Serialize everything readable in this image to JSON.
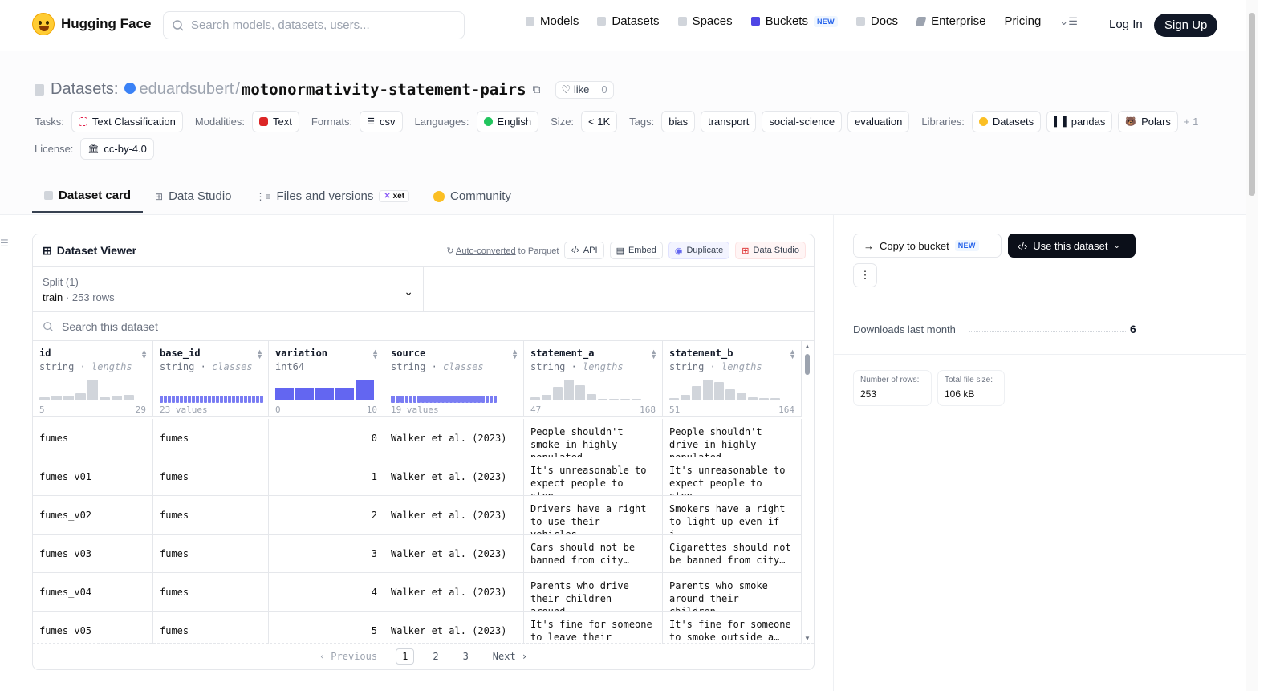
{
  "header": {
    "brand": "Hugging Face",
    "search_placeholder": "Search models, datasets, users...",
    "nav": [
      {
        "label": "Models"
      },
      {
        "label": "Datasets"
      },
      {
        "label": "Spaces"
      },
      {
        "label": "Buckets",
        "badge": "NEW"
      },
      {
        "label": "Docs"
      },
      {
        "label": "Enterprise"
      },
      {
        "label": "Pricing"
      }
    ],
    "login": "Log In",
    "signup": "Sign Up"
  },
  "dataset": {
    "prefix": "Datasets:",
    "owner": "eduardsubert",
    "separator": "/",
    "name": "motonormativity-statement-pairs",
    "like_label": "like",
    "like_count": "0",
    "tags": {
      "tasks_label": "Tasks:",
      "task": "Text Classification",
      "modalities_label": "Modalities:",
      "modality": "Text",
      "formats_label": "Formats:",
      "format": "csv",
      "languages_label": "Languages:",
      "language": "English",
      "size_label": "Size:",
      "size": "< 1K",
      "tags_label": "Tags:",
      "tag_items": [
        "bias",
        "transport",
        "social-science",
        "evaluation"
      ],
      "libraries_label": "Libraries:",
      "libraries": [
        "Datasets",
        "pandas",
        "Polars"
      ],
      "more": "+ 1",
      "license_label": "License:",
      "license": "cc-by-4.0"
    }
  },
  "tabs": [
    {
      "label": "Dataset card",
      "active": true
    },
    {
      "label": "Data Studio"
    },
    {
      "label": "Files and versions",
      "badge": "xet"
    },
    {
      "label": "Community"
    }
  ],
  "viewer": {
    "title": "Dataset Viewer",
    "auto_converted_link": "Auto-converted",
    "auto_converted_rest": " to Parquet",
    "api": "API",
    "embed": "Embed",
    "duplicate": "Duplicate",
    "data_studio": "Data Studio",
    "split_label": "Split (1)",
    "split_name": "train",
    "split_sep": "·",
    "split_rows": "253 rows",
    "search_placeholder": "Search this dataset",
    "columns": [
      {
        "name": "id",
        "type": "string",
        "stat": "lengths",
        "min": "5",
        "max": "29"
      },
      {
        "name": "base_id",
        "type": "string",
        "stat": "classes",
        "summary": "23 values"
      },
      {
        "name": "variation",
        "type": "int64",
        "stat": "",
        "min": "0",
        "max": "10"
      },
      {
        "name": "source",
        "type": "string",
        "stat": "classes",
        "summary": "19 values"
      },
      {
        "name": "statement_a",
        "type": "string",
        "stat": "lengths",
        "min": "47",
        "max": "168"
      },
      {
        "name": "statement_b",
        "type": "string",
        "stat": "lengths",
        "min": "51",
        "max": "164"
      }
    ],
    "rows": [
      [
        "fumes",
        "fumes",
        "0",
        "Walker et al. (2023)",
        "People shouldn't smoke in highly populated…",
        "People shouldn't drive in highly populated…"
      ],
      [
        "fumes_v01",
        "fumes",
        "1",
        "Walker et al. (2023)",
        "It's unreasonable to expect people to stop…",
        "It's unreasonable to expect people to stop…"
      ],
      [
        "fumes_v02",
        "fumes",
        "2",
        "Walker et al. (2023)",
        "Drivers have a right to use their vehicles…",
        "Smokers have a right to light up even if i…"
      ],
      [
        "fumes_v03",
        "fumes",
        "3",
        "Walker et al. (2023)",
        "Cars should not be banned from city…",
        "Cigarettes should not be banned from city…"
      ],
      [
        "fumes_v04",
        "fumes",
        "4",
        "Walker et al. (2023)",
        "Parents who drive their children around…",
        "Parents who smoke around their children…"
      ],
      [
        "fumes_v05",
        "fumes",
        "5",
        "Walker et al. (2023)",
        "It's fine for someone to leave their engine…",
        "It's fine for someone to smoke outside a…"
      ]
    ],
    "pager": {
      "previous": "Previous",
      "pages": [
        "1",
        "2",
        "3"
      ],
      "current": "1",
      "next": "Next"
    }
  },
  "sidebar": {
    "copy_to_bucket": "Copy to bucket",
    "copy_badge": "NEW",
    "use_dataset": "Use this dataset",
    "downloads_label": "Downloads last month",
    "downloads_value": "6",
    "rows_label": "Number of rows:",
    "rows_value": "253",
    "size_label": "Total file size:",
    "size_value": "106 kB"
  },
  "colors": {
    "accent": "#6366f1",
    "brand": "#ffcc33",
    "dark": "#0b0f19"
  }
}
